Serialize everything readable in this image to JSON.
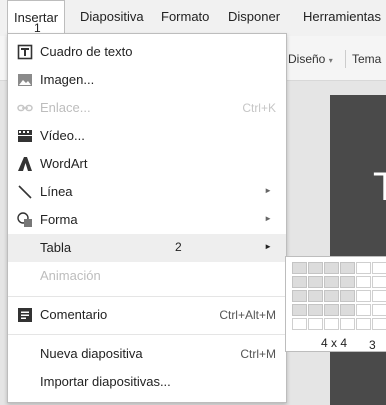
{
  "menubar": {
    "items": [
      "Insertar",
      "Diapositiva",
      "Formato",
      "Disponer",
      "Herramientas"
    ]
  },
  "toolbar": {
    "design": "Diseño",
    "theme": "Tema",
    "design_caret": "▾"
  },
  "slide": {
    "letter": "T"
  },
  "annotations": {
    "a1": "1",
    "a2": "2",
    "a3": "3"
  },
  "insert_menu": {
    "items": [
      {
        "label": "Cuadro de texto",
        "icon": "textbox-icon"
      },
      {
        "label": "Imagen...",
        "icon": "image-icon"
      },
      {
        "label": "Enlace...",
        "icon": "link-icon",
        "shortcut": "Ctrl+K",
        "disabled": true
      },
      {
        "label": "Vídeo...",
        "icon": "video-icon"
      },
      {
        "label": "WordArt",
        "icon": "wordart-icon"
      },
      {
        "label": "Línea",
        "icon": "line-icon",
        "submenu": true
      },
      {
        "label": "Forma",
        "icon": "shape-icon",
        "submenu": true
      },
      {
        "label": "Tabla",
        "submenu": true,
        "highlighted": true
      },
      {
        "label": "Animación",
        "disabled": true
      },
      {
        "label": "Comentario",
        "icon": "comment-icon",
        "shortcut": "Ctrl+Alt+M"
      },
      {
        "label": "Nueva diapositiva",
        "shortcut": "Ctrl+M"
      },
      {
        "label": "Importar diapositivas..."
      }
    ],
    "arrow_glyph": "►"
  },
  "table_submenu": {
    "grid_label": "4 x 4",
    "selected_rows": 4,
    "selected_cols": 4
  }
}
